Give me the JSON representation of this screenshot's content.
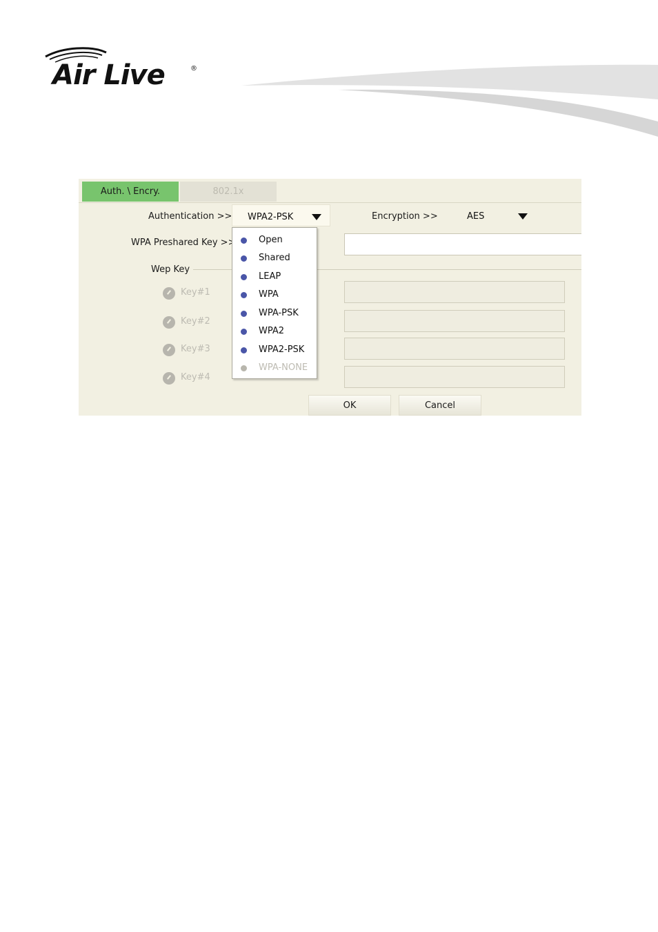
{
  "header": {
    "logo_text": "Air Live",
    "logo_reg": "®"
  },
  "dialog": {
    "tabs": [
      {
        "label": "Auth. \\ Encry.",
        "active": true
      },
      {
        "label": "802.1x",
        "active": false
      }
    ],
    "authentication": {
      "label": "Authentication >>",
      "value": "WPA2-PSK",
      "options": [
        {
          "label": "Open",
          "enabled": true
        },
        {
          "label": "Shared",
          "enabled": true
        },
        {
          "label": "LEAP",
          "enabled": true
        },
        {
          "label": "WPA",
          "enabled": true
        },
        {
          "label": "WPA-PSK",
          "enabled": true
        },
        {
          "label": "WPA2",
          "enabled": true
        },
        {
          "label": "WPA2-PSK",
          "enabled": true
        },
        {
          "label": "WPA-NONE",
          "enabled": false
        }
      ]
    },
    "encryption": {
      "label": "Encryption >>",
      "value": "AES"
    },
    "wpa_preshared_key": {
      "label": "WPA Preshared Key >>",
      "value": ""
    },
    "wep_key": {
      "label": "Wep Key",
      "keys": [
        {
          "label": "Key#1"
        },
        {
          "label": "Key#2"
        },
        {
          "label": "Key#3"
        },
        {
          "label": "Key#4"
        }
      ]
    },
    "buttons": {
      "ok": "OK",
      "cancel": "Cancel"
    }
  },
  "colors": {
    "active_tab": "#78c46d",
    "dialog_bg": "#f2f0e2",
    "bullet_enabled": "#4a56a8",
    "bullet_disabled": "#b8b6ad",
    "disabled_text": "#bdbbb2"
  }
}
